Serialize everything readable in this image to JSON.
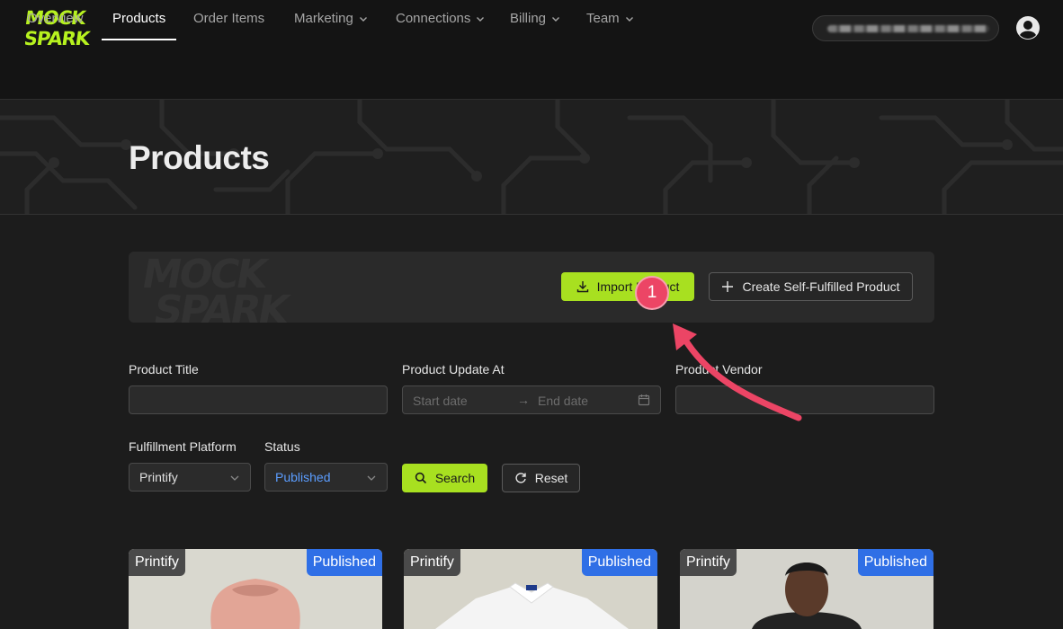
{
  "header": {
    "logo_text": "MOCK SPARK",
    "account_label": "shop.myshopify.com",
    "nav": [
      {
        "label": "Overview",
        "dropdown": false
      },
      {
        "label": "Products",
        "dropdown": false,
        "active": true
      },
      {
        "label": "Order Items",
        "dropdown": false
      },
      {
        "label": "Marketing",
        "dropdown": true
      },
      {
        "label": "Connections",
        "dropdown": true
      },
      {
        "label": "Billing",
        "dropdown": true
      },
      {
        "label": "Team",
        "dropdown": true
      }
    ]
  },
  "page": {
    "title": "Products"
  },
  "actions": {
    "import_label": "Import Product",
    "create_label": "Create Self-Fulfilled Product"
  },
  "annotation": {
    "step": "1",
    "color": "#ec4565"
  },
  "filters": {
    "product_title_label": "Product Title",
    "product_title_value": "",
    "update_at_label": "Product Update At",
    "start_placeholder": "Start date",
    "end_placeholder": "End date",
    "vendor_label": "Product Vendor",
    "vendor_value": "",
    "platform_label": "Fulfillment Platform",
    "platform_value": "Printify",
    "status_label": "Status",
    "status_value": "Published",
    "search_label": "Search",
    "reset_label": "Reset"
  },
  "products": [
    {
      "platform": "Printify",
      "status": "Published",
      "image": "pink-hoodie"
    },
    {
      "platform": "Printify",
      "status": "Published",
      "image": "white-polo"
    },
    {
      "platform": "Printify",
      "status": "Published",
      "image": "man-dark-jacket"
    }
  ],
  "colors": {
    "accent": "#a8e020",
    "background": "#1c1c1c",
    "status_badge": "#2f6fe6"
  }
}
